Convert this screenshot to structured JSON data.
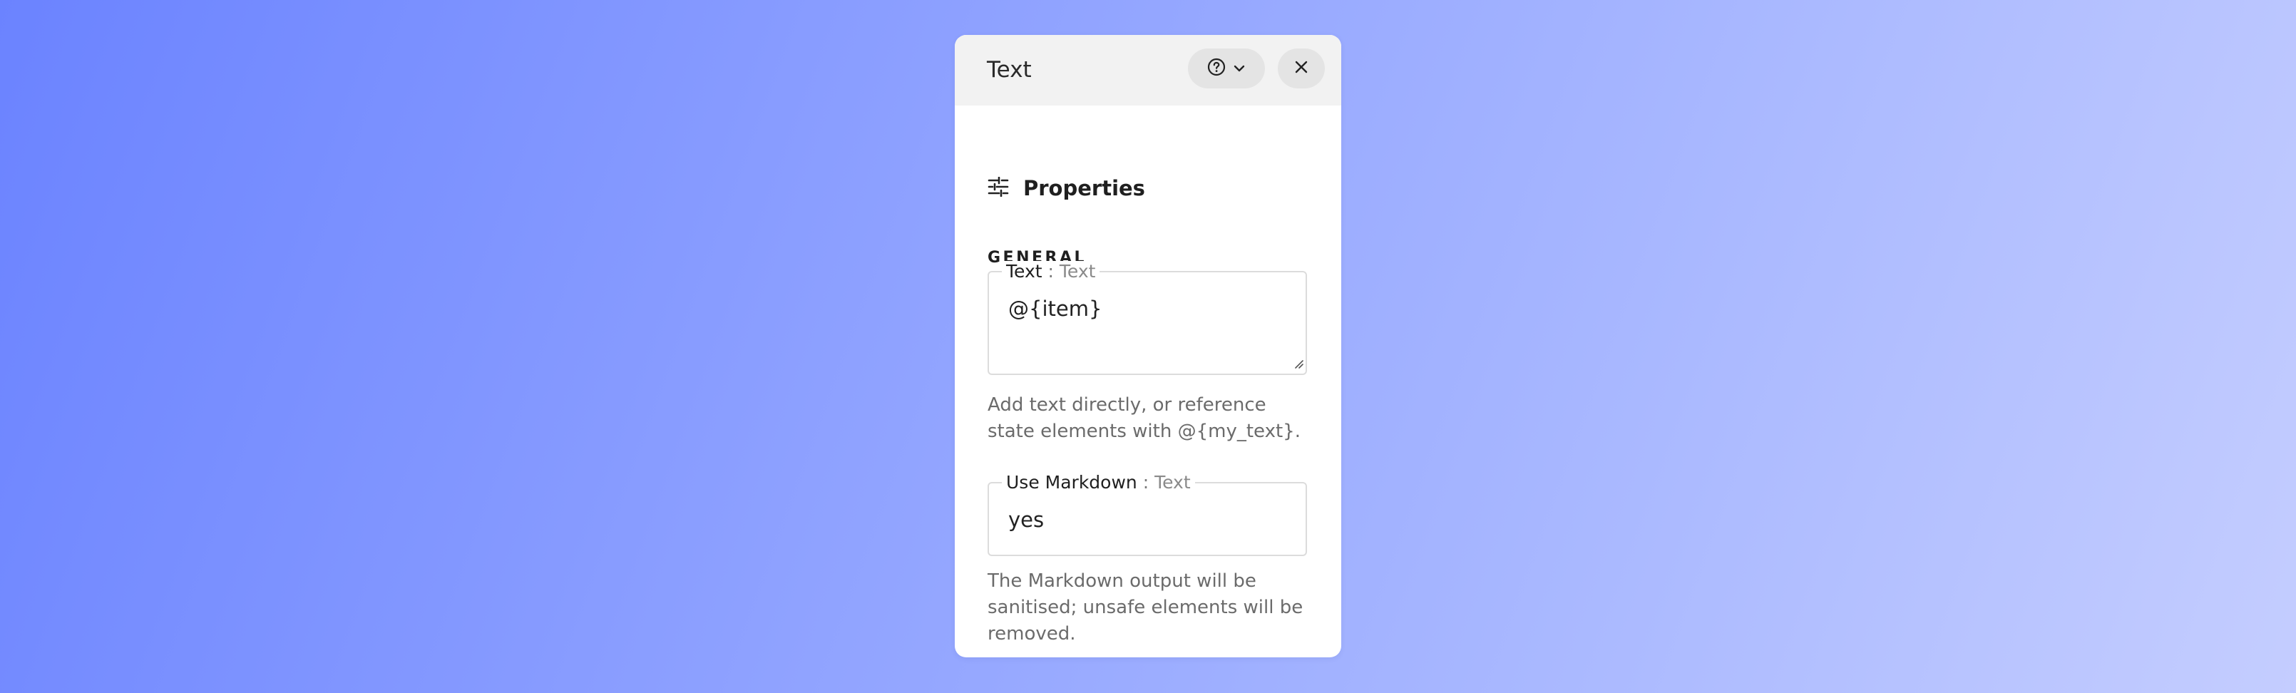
{
  "panel": {
    "title": "Text",
    "help_icon": "question-circle-icon",
    "dropdown_icon": "chevron-down-icon",
    "close_icon": "close-icon"
  },
  "section": {
    "icon": "sliders-icon",
    "title": "Properties"
  },
  "group": {
    "label": "GENERAL"
  },
  "fields": {
    "text": {
      "name": "Text",
      "separator": " : ",
      "type": "Text",
      "value": "@{item}",
      "help": "Add text directly, or reference state elements with @{my_text}."
    },
    "markdown": {
      "name": "Use Markdown",
      "separator": " : ",
      "type": "Text",
      "value": "yes",
      "help": "The Markdown output will be sanitised; unsafe elements will be removed."
    }
  }
}
